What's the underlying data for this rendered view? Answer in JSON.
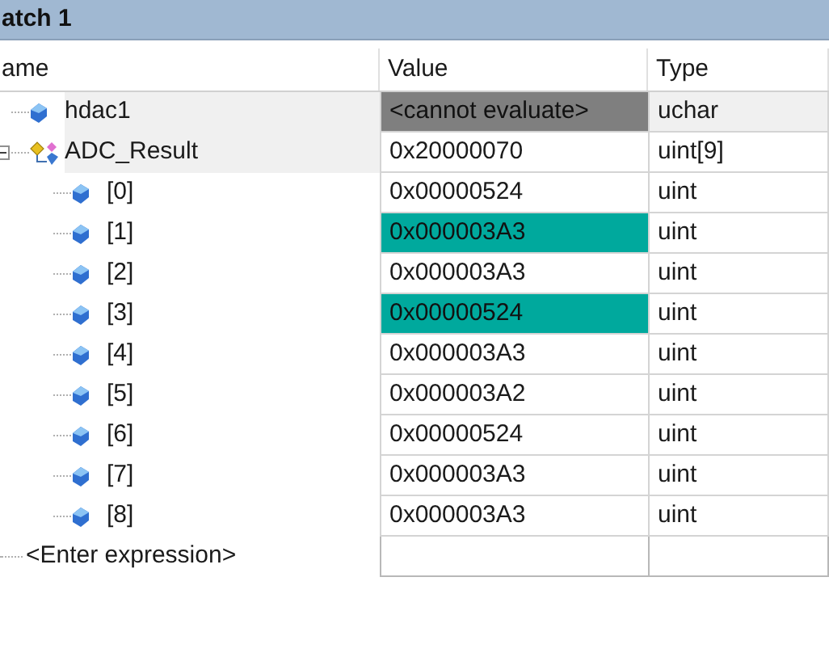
{
  "window": {
    "title": "atch 1"
  },
  "table": {
    "columns": [
      "ame",
      "Value",
      "Type"
    ],
    "rows": [
      {
        "name": "hdac1",
        "kind": "variable",
        "value": "<cannot evaluate>",
        "error": true,
        "changed": false,
        "type": "uchar"
      },
      {
        "name": "ADC_Result",
        "kind": "struct",
        "value": "0x20000070",
        "error": false,
        "changed": false,
        "type": "uint[9]",
        "expanded": true,
        "children": [
          {
            "name": "[0]",
            "kind": "variable",
            "value": "0x00000524",
            "changed": false,
            "type": "uint"
          },
          {
            "name": "[1]",
            "kind": "variable",
            "value": "0x000003A3",
            "changed": true,
            "type": "uint"
          },
          {
            "name": "[2]",
            "kind": "variable",
            "value": "0x000003A3",
            "changed": false,
            "type": "uint"
          },
          {
            "name": "[3]",
            "kind": "variable",
            "value": "0x00000524",
            "changed": true,
            "type": "uint"
          },
          {
            "name": "[4]",
            "kind": "variable",
            "value": "0x000003A3",
            "changed": false,
            "type": "uint"
          },
          {
            "name": "[5]",
            "kind": "variable",
            "value": "0x000003A2",
            "changed": false,
            "type": "uint"
          },
          {
            "name": "[6]",
            "kind": "variable",
            "value": "0x00000524",
            "changed": false,
            "type": "uint"
          },
          {
            "name": "[7]",
            "kind": "variable",
            "value": "0x000003A3",
            "changed": false,
            "type": "uint"
          },
          {
            "name": "[8]",
            "kind": "variable",
            "value": "0x000003A3",
            "changed": false,
            "type": "uint"
          }
        ]
      }
    ],
    "new_row": {
      "placeholder": "<Enter expression>"
    }
  }
}
